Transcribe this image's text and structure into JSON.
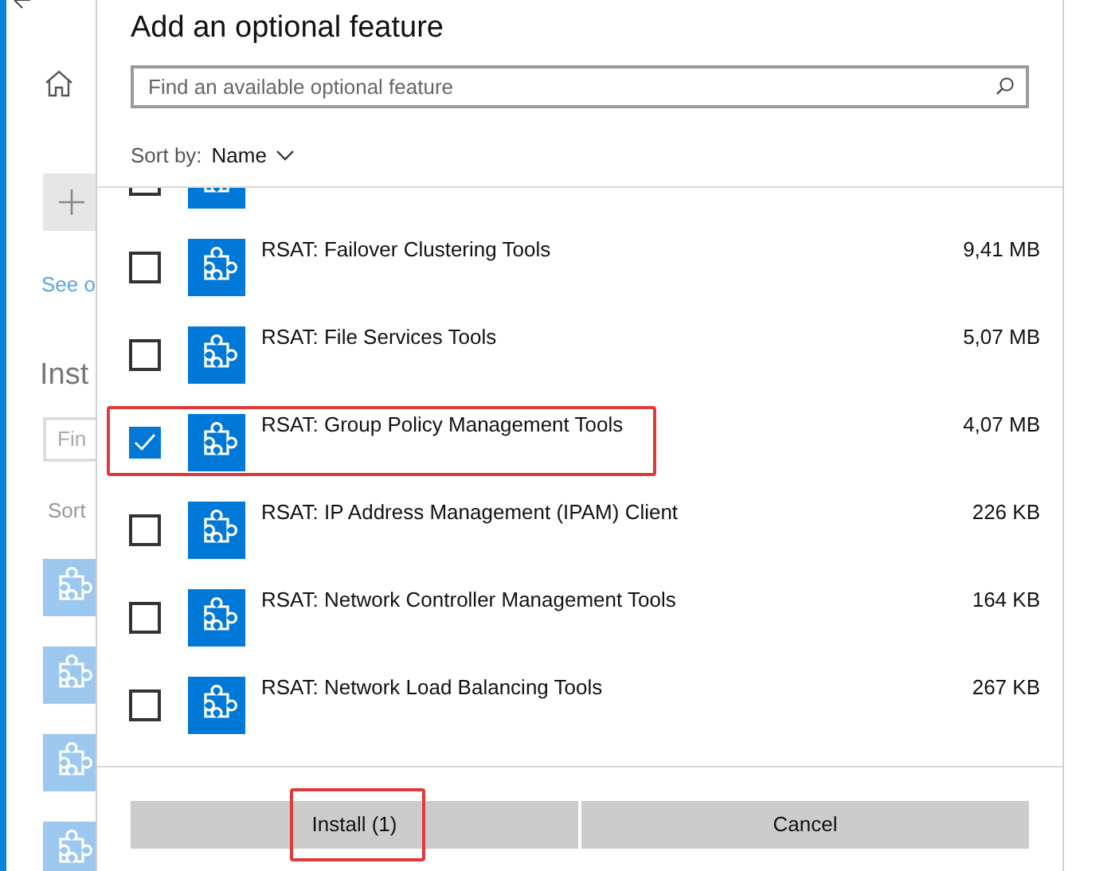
{
  "background_window": {
    "link": "See o",
    "heading": "Inst",
    "search_placeholder": "Fin",
    "sort_label": "Sort",
    "installed_features": [
      {
        "kind": "puzzle"
      },
      {
        "kind": "puzzle"
      },
      {
        "kind": "puzzle"
      },
      {
        "kind": "puzzle"
      }
    ]
  },
  "dialog": {
    "title": "Add an optional feature",
    "search": {
      "placeholder": "Find an available optional feature"
    },
    "sort": {
      "label": "Sort by:",
      "value": "Name"
    },
    "features": [
      {
        "checked": false,
        "highlighted": false
      },
      {
        "name": "RSAT: Failover Clustering Tools",
        "size": "9,41 MB",
        "checked": false,
        "highlighted": false
      },
      {
        "name": "RSAT: File Services Tools",
        "size": "5,07 MB",
        "checked": false,
        "highlighted": false
      },
      {
        "name": "RSAT: Group Policy Management Tools",
        "size": "4,07 MB",
        "checked": true,
        "highlighted": true
      },
      {
        "name": "RSAT: IP Address Management (IPAM) Client",
        "size": "226 KB",
        "checked": false,
        "highlighted": false
      },
      {
        "name": "RSAT: Network Controller Management Tools",
        "size": "164 KB",
        "checked": false,
        "highlighted": false
      },
      {
        "name": "RSAT: Network Load Balancing Tools",
        "size": "267 KB",
        "checked": false,
        "highlighted": false
      }
    ],
    "buttons": [
      {
        "label": "Install (1)",
        "highlighted": true
      },
      {
        "label": "Cancel",
        "highlighted": false
      }
    ]
  }
}
